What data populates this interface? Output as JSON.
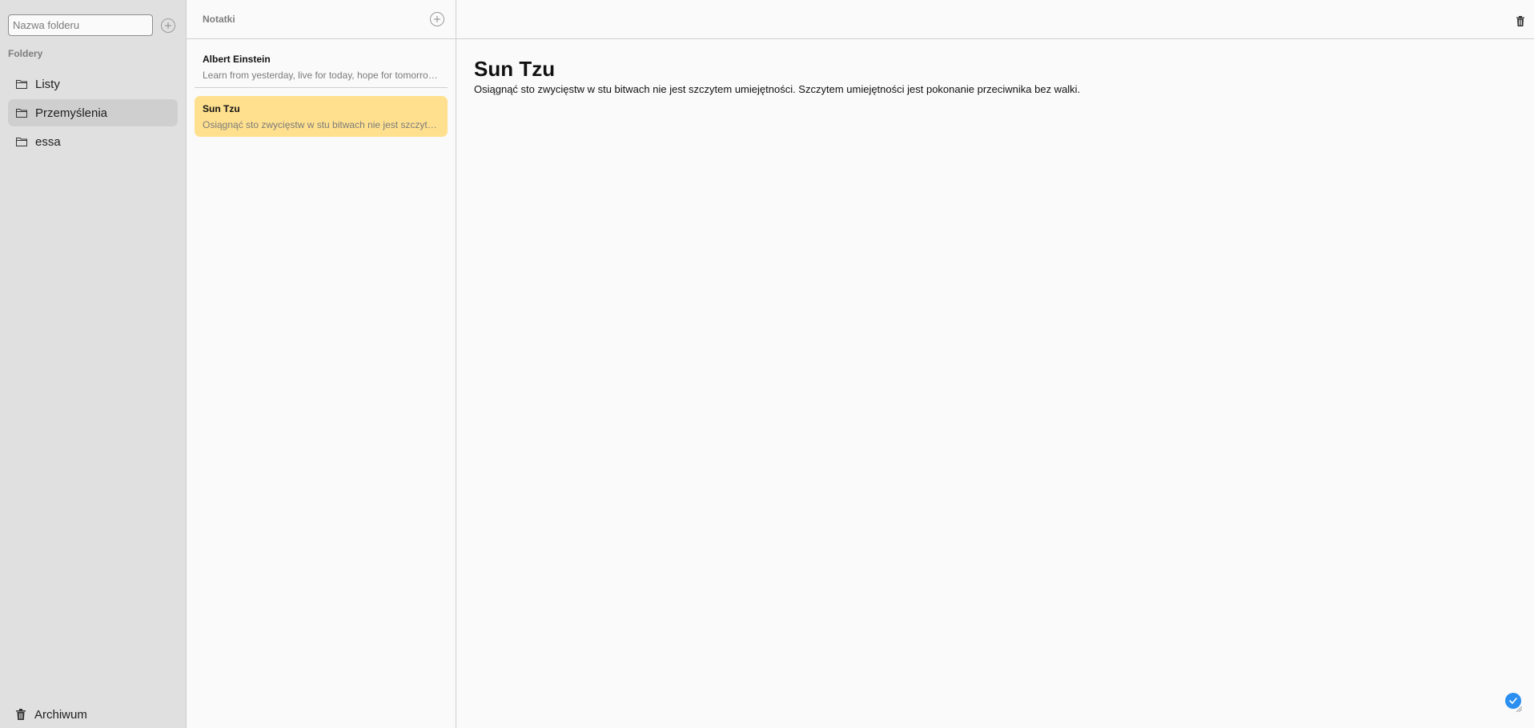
{
  "sidebar": {
    "folder_input_placeholder": "Nazwa folderu",
    "section_label": "Foldery",
    "folders": [
      {
        "label": "Listy",
        "icon": "folder-icon"
      },
      {
        "label": "Przemyślenia",
        "icon": "folder-icon",
        "active": true
      },
      {
        "label": "essa",
        "icon": "folder-icon"
      }
    ],
    "archive_label": "Archiwum"
  },
  "notes": {
    "title": "Notatki",
    "items": [
      {
        "title": "Albert Einstein",
        "preview": "Learn from yesterday, live for today, hope for tomorrow. The important thing is not to stop questioning."
      },
      {
        "title": "Sun Tzu",
        "preview": "Osiągnąć sto zwycięstw w stu bitwach nie jest szczytem umiejętności. Szczytem umiejętności jest pokonanie przeciwnika bez walki.",
        "active": true
      }
    ]
  },
  "editor": {
    "title": "Sun Tzu",
    "text": "Osiągnąć sto zwycięstw w stu bitwach nie jest szczytem umiejętności. Szczytem umiejętności jest pokonanie przeciwnika bez walki."
  },
  "colors": {
    "sidebar_bg": "#e0e0e0",
    "active_note": "#ffe08e",
    "accent": "#2a8ff0"
  }
}
